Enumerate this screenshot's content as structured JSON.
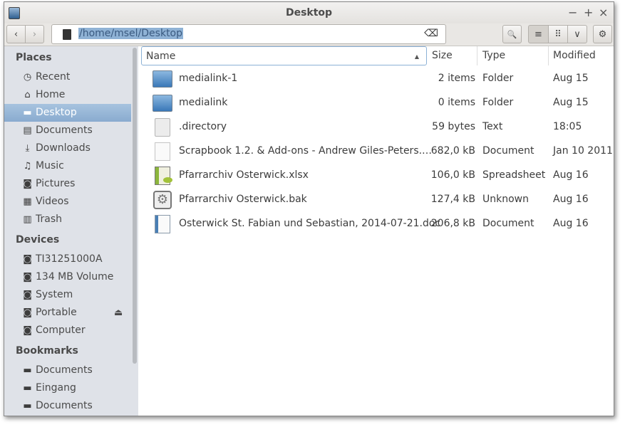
{
  "window": {
    "title": "Desktop",
    "controls": {
      "minimize": "−",
      "maximize": "+",
      "close": "×"
    }
  },
  "toolbar": {
    "back": "‹",
    "forward": "›",
    "location": "/home/msel/Desktop",
    "clear": "⌫",
    "search": "🔍",
    "list": "≡",
    "grid": "⠿",
    "view_menu": "∨",
    "settings": "⚙"
  },
  "sidebar": {
    "places_title": "Places",
    "places": [
      {
        "label": "Recent",
        "icon": "clock-icon",
        "g": "◷"
      },
      {
        "label": "Home",
        "icon": "home-icon",
        "g": "⌂"
      },
      {
        "label": "Desktop",
        "icon": "folder-icon",
        "g": "▬"
      },
      {
        "label": "Documents",
        "icon": "document-icon",
        "g": "▤"
      },
      {
        "label": "Downloads",
        "icon": "download-icon",
        "g": "⤓"
      },
      {
        "label": "Music",
        "icon": "music-icon",
        "g": "♫"
      },
      {
        "label": "Pictures",
        "icon": "camera-icon",
        "g": "◙"
      },
      {
        "label": "Videos",
        "icon": "film-icon",
        "g": "▦"
      },
      {
        "label": "Trash",
        "icon": "trash-icon",
        "g": "▥"
      }
    ],
    "devices_title": "Devices",
    "devices": [
      {
        "label": "TI31251000A",
        "g": "◙"
      },
      {
        "label": "134 MB Volume",
        "g": "◙"
      },
      {
        "label": "System",
        "g": "◙"
      },
      {
        "label": "Portable",
        "g": "◙"
      },
      {
        "label": "Computer",
        "g": "◙"
      }
    ],
    "eject": "⏏",
    "bookmarks_title": "Bookmarks",
    "bookmarks": [
      {
        "label": "Documents",
        "g": "▬"
      },
      {
        "label": "Eingang",
        "g": "▬"
      },
      {
        "label": "Documents",
        "g": "▬"
      }
    ]
  },
  "columns": {
    "name": "Name",
    "size": "Size",
    "type": "Type",
    "modified": "Modified",
    "sort": "▲"
  },
  "files": [
    {
      "name": "medialink-1",
      "size": "2 items",
      "type": "Folder",
      "modified": "Aug 15",
      "icon": "folder"
    },
    {
      "name": "medialink",
      "size": "0 items",
      "type": "Folder",
      "modified": "Aug 15",
      "icon": "folder"
    },
    {
      "name": ".directory",
      "size": "59 bytes",
      "type": "Text",
      "modified": "18:05",
      "icon": "text"
    },
    {
      "name": "Scrapbook 1.2. & Add-ons - Andrew Giles-Peters.…",
      "size": "682,0 kB",
      "type": "Document",
      "modified": "Jan 10 2011",
      "icon": "pdf"
    },
    {
      "name": "Pfarrarchiv Osterwick.xlsx",
      "size": "106,0 kB",
      "type": "Spreadsheet",
      "modified": "Aug 16",
      "icon": "sheet"
    },
    {
      "name": "Pfarrarchiv Osterwick.bak",
      "size": "127,4 kB",
      "type": "Unknown",
      "modified": "Aug 16",
      "icon": "gear"
    },
    {
      "name": "Osterwick St. Fabian und Sebastian, 2014-07-21.doc",
      "size": "206,8 kB",
      "type": "Document",
      "modified": "Aug 16",
      "icon": "doc"
    }
  ]
}
